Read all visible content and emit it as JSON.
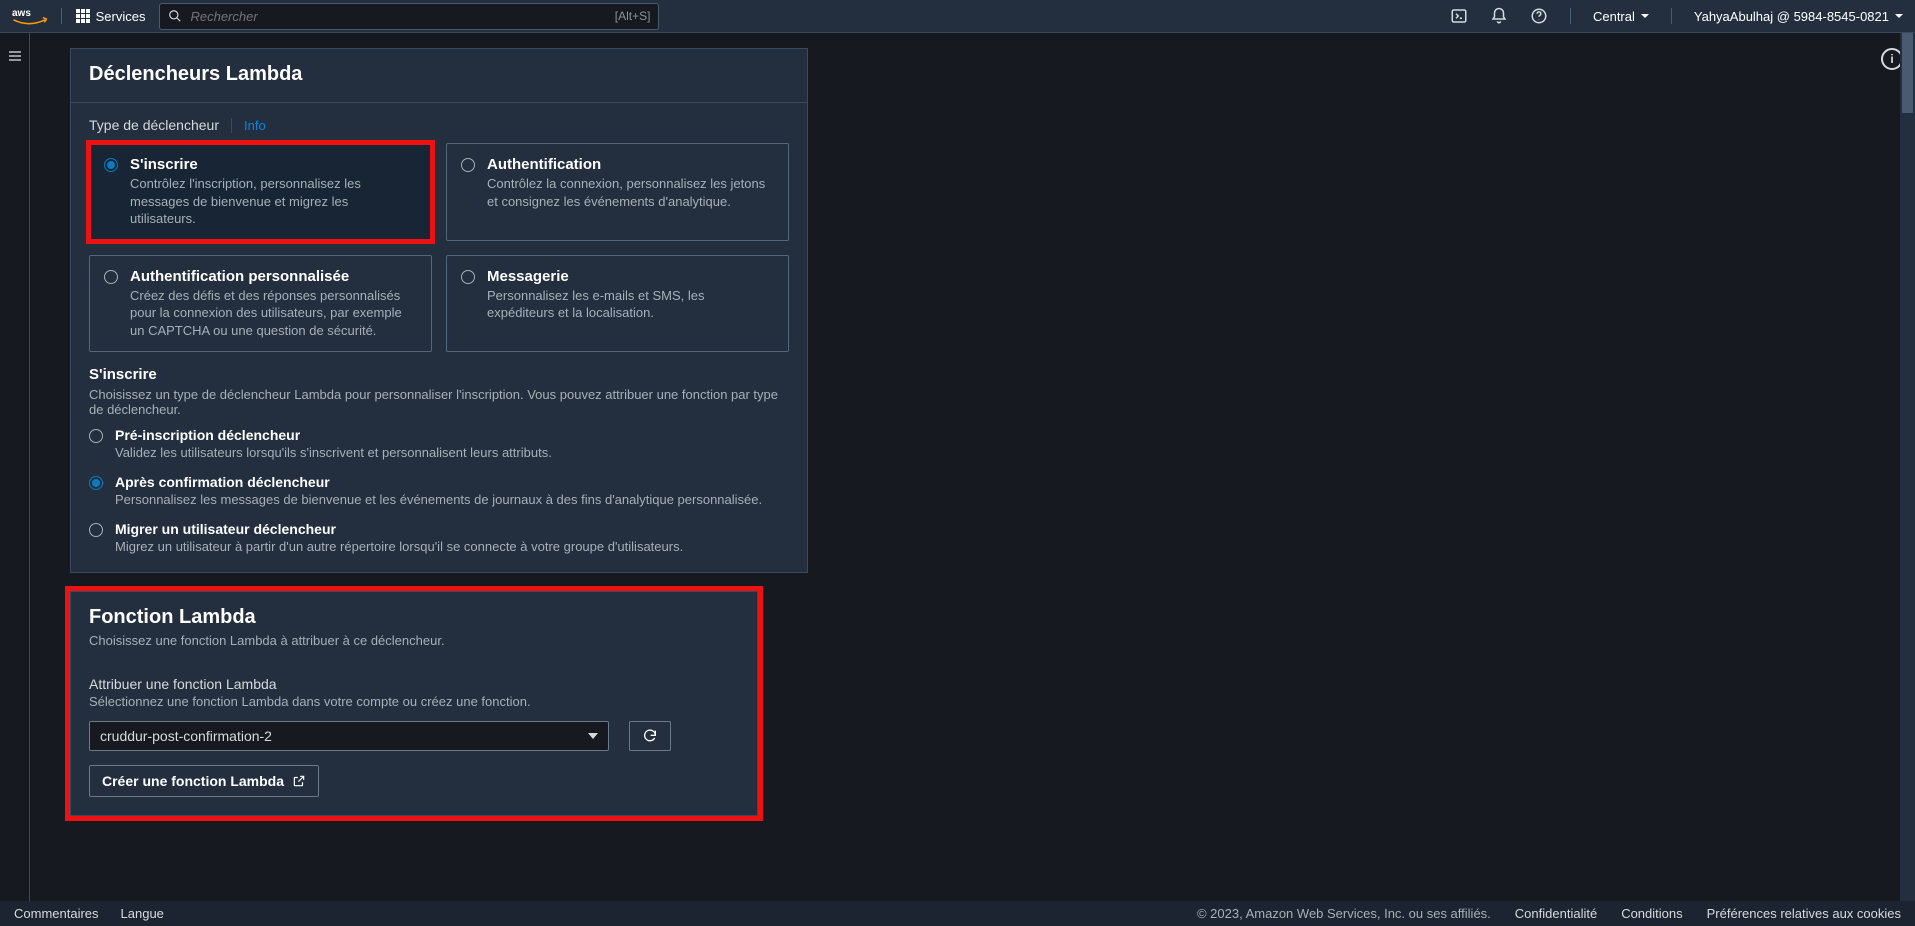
{
  "header": {
    "services_label": "Services",
    "search_placeholder": "Rechercher",
    "search_shortcut": "[Alt+S]",
    "region_label": "Central",
    "account_label": "YahyaAbulhaj @ 5984-8545-0821"
  },
  "main": {
    "panel1": {
      "title": "Déclencheurs Lambda",
      "section_label": "Type de déclencheur",
      "info_link": "Info",
      "trigger_cards": [
        {
          "title": "S'inscrire",
          "desc": "Contrôlez l'inscription, personnalisez les messages de bienvenue et migrez les utilisateurs.",
          "selected": true
        },
        {
          "title": "Authentification",
          "desc": "Contrôlez la connexion, personnalisez les jetons et consignez les événements d'analytique.",
          "selected": false
        },
        {
          "title": "Authentification personnalisée",
          "desc": "Créez des défis et des réponses personnalisés pour la connexion des utilisateurs, par exemple un CAPTCHA ou une question de sécurité.",
          "selected": false
        },
        {
          "title": "Messagerie",
          "desc": "Personnalisez les e-mails et SMS, les expéditeurs et la localisation.",
          "selected": false
        }
      ],
      "subsection": {
        "title": "S'inscrire",
        "desc": "Choisissez un type de déclencheur Lambda pour personnaliser l'inscription. Vous pouvez attribuer une fonction par type de déclencheur.",
        "options": [
          {
            "label": "Pré-inscription déclencheur",
            "desc": "Validez les utilisateurs lorsqu'ils s'inscrivent et personnalisent leurs attributs.",
            "checked": false
          },
          {
            "label": "Après confirmation déclencheur",
            "desc": "Personnalisez les messages de bienvenue et les événements de journaux à des fins d'analytique personnalisée.",
            "checked": true
          },
          {
            "label": "Migrer un utilisateur déclencheur",
            "desc": "Migrez un utilisateur à partir d'un autre répertoire lorsqu'il se connecte à votre groupe d'utilisateurs.",
            "checked": false
          }
        ]
      }
    },
    "panel2": {
      "title": "Fonction Lambda",
      "subtitle": "Choisissez une fonction Lambda à attribuer à ce déclencheur.",
      "field_label": "Attribuer une fonction Lambda",
      "field_desc": "Sélectionnez une fonction Lambda dans votre compte ou créez une fonction.",
      "select_value": "cruddur-post-confirmation-2",
      "create_button": "Créer une fonction Lambda"
    }
  },
  "footer": {
    "comments": "Commentaires",
    "language": "Langue",
    "copyright": "© 2023, Amazon Web Services, Inc. ou ses affiliés.",
    "privacy": "Confidentialité",
    "terms": "Conditions",
    "cookies": "Préférences relatives aux cookies"
  }
}
